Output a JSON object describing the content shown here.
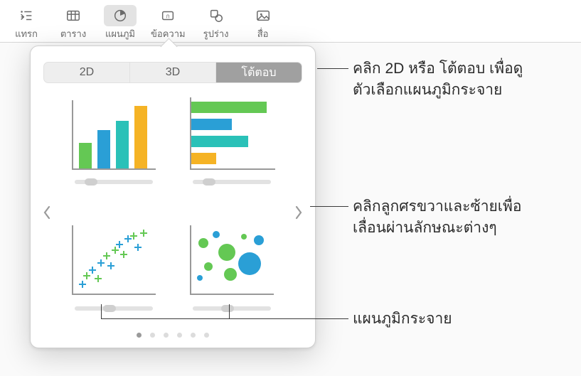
{
  "toolbar": {
    "items": [
      {
        "label": "แทรก",
        "icon": "insert-indent-icon"
      },
      {
        "label": "ตาราง",
        "icon": "table-icon"
      },
      {
        "label": "แผนภูมิ",
        "icon": "chart-pie-icon",
        "active": true
      },
      {
        "label": "ข้อความ",
        "icon": "text-box-icon"
      },
      {
        "label": "รูปร่าง",
        "icon": "shape-icon"
      },
      {
        "label": "สื่อ",
        "icon": "media-icon"
      }
    ]
  },
  "popover": {
    "tabs": {
      "tab1": "2D",
      "tab2": "3D",
      "tab3": "โต้ตอบ",
      "selected": "โต้ตอบ"
    },
    "nav": {
      "left_icon": "chevron-left-icon",
      "right_icon": "chevron-right-icon"
    },
    "charts": [
      {
        "name": "column-chart-option",
        "kind": "bar-vertical"
      },
      {
        "name": "bar-chart-option",
        "kind": "bar-horizontal"
      },
      {
        "name": "scatter-chart-option",
        "kind": "scatter"
      },
      {
        "name": "bubble-chart-option",
        "kind": "bubble"
      }
    ],
    "page_dots": {
      "count": 6,
      "active": 0
    }
  },
  "callouts": {
    "c1_line1": "คลิก 2D หรือ โต้ตอบ เพื่อดู",
    "c1_line2": "ตัวเลือกแผนภูมิกระจาย",
    "c2_line1": "คลิกลูกศรขวาและซ้ายเพื่อ",
    "c2_line2": "เลื่อนผ่านลักษณะต่างๆ",
    "c3_line1": "แผนภูมิกระจาย"
  },
  "colors": {
    "green": "#64c854",
    "blue": "#2a9fd6",
    "teal": "#2ac1b8",
    "orange": "#f5b325"
  }
}
